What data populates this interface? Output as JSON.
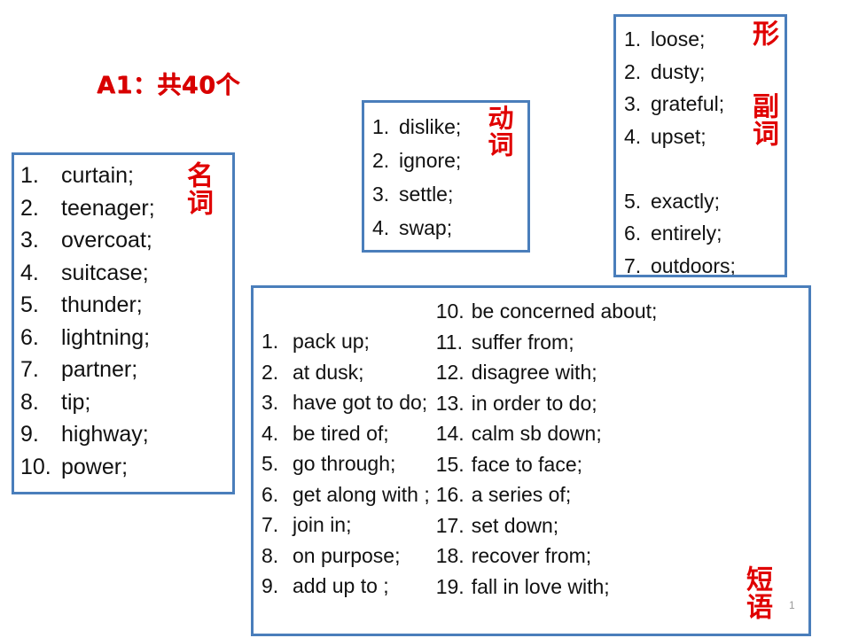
{
  "slide": {
    "title": "A1：共40个",
    "page_number": "1",
    "accent_border_color": "#4A7EBB",
    "label_color": "#E00000",
    "title_color": "#D80000"
  },
  "nouns": {
    "pos_label": "名词",
    "items": [
      {
        "num": "1.",
        "text": "curtain;"
      },
      {
        "num": "2.",
        "text": "teenager;"
      },
      {
        "num": "3.",
        "text": "overcoat;"
      },
      {
        "num": "4.",
        "text": "suitcase;"
      },
      {
        "num": "5.",
        "text": "thunder;"
      },
      {
        "num": "6.",
        "text": "lightning;"
      },
      {
        "num": "7.",
        "text": "partner;"
      },
      {
        "num": "8.",
        "text": "tip;"
      },
      {
        "num": "9.",
        "text": "highway;"
      },
      {
        "num": "10.",
        "text": "power;"
      }
    ]
  },
  "verbs": {
    "pos_label": "动词",
    "items": [
      {
        "num": "1.",
        "text": "dislike;"
      },
      {
        "num": "2.",
        "text": "ignore;"
      },
      {
        "num": "3.",
        "text": "settle;"
      },
      {
        "num": "4.",
        "text": "swap;"
      }
    ]
  },
  "adjectives_adverbs": {
    "adj_label": "形",
    "adv_label": "副词",
    "items": [
      {
        "num": "1.",
        "text": "loose;"
      },
      {
        "num": "2.",
        "text": "dusty;"
      },
      {
        "num": "3.",
        "text": "grateful;"
      },
      {
        "num": "4.",
        "text": "upset;"
      },
      {
        "num": "",
        "text": ""
      },
      {
        "num": "5.",
        "text": "exactly;"
      },
      {
        "num": "6.",
        "text": "entirely;"
      },
      {
        "num": "7.",
        "text": "outdoors;"
      }
    ]
  },
  "phrases": {
    "pos_label": "短语",
    "left_items": [
      {
        "num": "1.",
        "text": "pack up;"
      },
      {
        "num": "2.",
        "text": "at dusk;"
      },
      {
        "num": "3.",
        "text": "have got to do;"
      },
      {
        "num": "4.",
        "text": "be tired of;"
      },
      {
        "num": "5.",
        "text": "go through;"
      },
      {
        "num": "6.",
        "text": "get along with ;"
      },
      {
        "num": "7.",
        "text": "join in;"
      },
      {
        "num": "8.",
        "text": "on purpose;"
      },
      {
        "num": "9.",
        "text": "add up to ;"
      }
    ],
    "right_items": [
      {
        "num": "10.",
        "text": "be concerned about;"
      },
      {
        "num": "11.",
        "text": "suffer from;"
      },
      {
        "num": "12.",
        "text": "disagree with;"
      },
      {
        "num": "13.",
        "text": "in order to do;"
      },
      {
        "num": "14.",
        "text": "calm sb down;"
      },
      {
        "num": "15.",
        "text": "face to face;"
      },
      {
        "num": "16.",
        "text": "a series of;"
      },
      {
        "num": "17.",
        "text": "set down;"
      },
      {
        "num": "18.",
        "text": "recover from;"
      },
      {
        "num": "19.",
        "text": "fall in love with;"
      }
    ]
  }
}
